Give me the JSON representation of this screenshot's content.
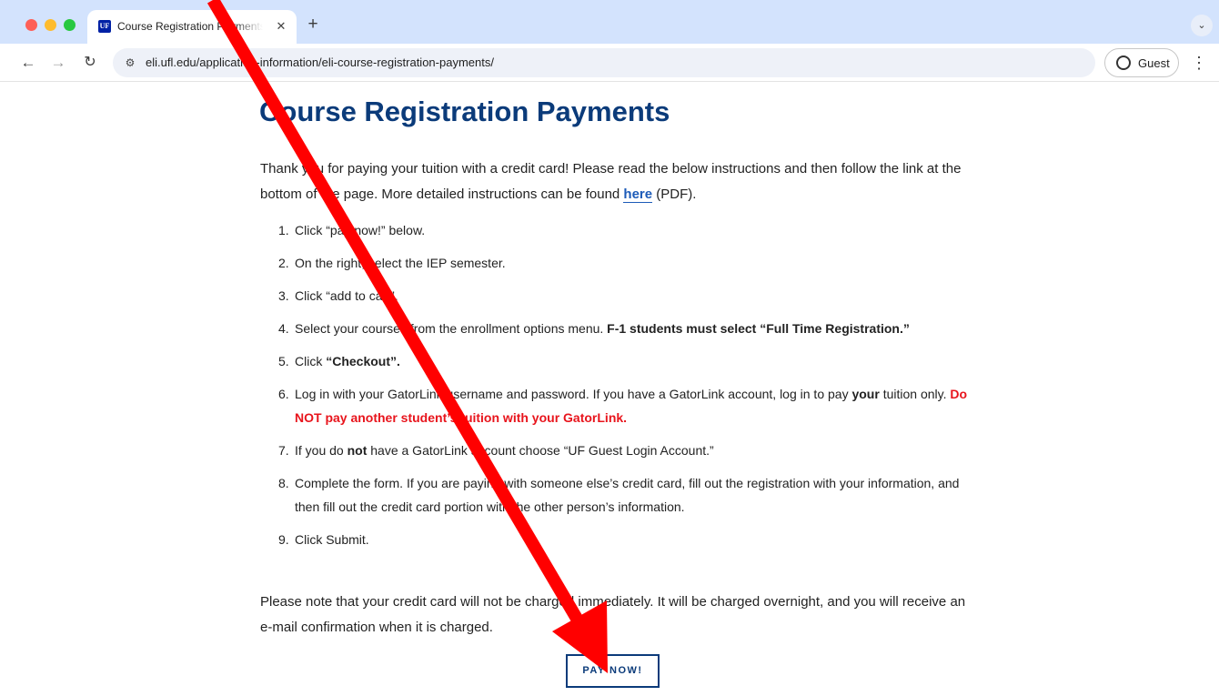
{
  "browser": {
    "tab": {
      "favicon_text": "UF",
      "title": "Course Registration Payments",
      "close": "✕"
    },
    "new_tab": "+",
    "tab_menu": "⌄",
    "nav": {
      "back": "←",
      "forward": "→",
      "reload": "↻"
    },
    "site_info_icon": "⚙",
    "url": "eli.ufl.edu/application-information/eli-course-registration-payments/",
    "profile_label": "Guest",
    "menu": "⋮"
  },
  "page": {
    "title": "Course Registration Payments",
    "intro": {
      "before": "Thank you for paying your tuition with a credit card! Please read the below instructions and then follow the link at the bottom of the page. More detailed instructions can be found ",
      "link": "here",
      "after": " (PDF)."
    },
    "steps": [
      {
        "num": "1.",
        "text": "Click “pay now!” below."
      },
      {
        "num": "2.",
        "text": "On the right, select the IEP semester."
      },
      {
        "num": "3.",
        "text": "Click “add to cart”."
      },
      {
        "num": "4.",
        "text": "Select your courses from the enrollment options menu. ",
        "bold": "F-1 students must select “Full Time Registration.”"
      },
      {
        "num": "5.",
        "text": "Click ",
        "bold": "“Checkout”."
      },
      {
        "num": "6.",
        "text": "Log in with your GatorLink username and password.  If you have a GatorLink account, log in to pay ",
        "bold": "your",
        "text2": " tuition only. ",
        "red": "Do NOT pay another student’s tuition with your GatorLink."
      },
      {
        "num": "7.",
        "text": "If you do ",
        "bold": "not",
        "text2": " have a GatorLink account choose “UF Guest Login Account.”"
      },
      {
        "num": "8.",
        "text": "Complete the form. If you are paying with someone else’s credit card, fill out the registration with your information, and then fill out the credit card portion with the other person’s information."
      },
      {
        "num": "9.",
        "text": "Click Submit."
      }
    ],
    "note": "Please note that your credit card will not be charged immediately. It will be charged overnight, and you will receive an e-mail confirmation when it is charged.",
    "pay_button": "PAY NOW!"
  },
  "colors": {
    "title_blue": "#0b3b7a",
    "link_blue": "#1d5bb8",
    "warning_red": "#e8141c",
    "annotation_arrow": "#ff0000",
    "tab_strip": "#d3e3fd"
  }
}
